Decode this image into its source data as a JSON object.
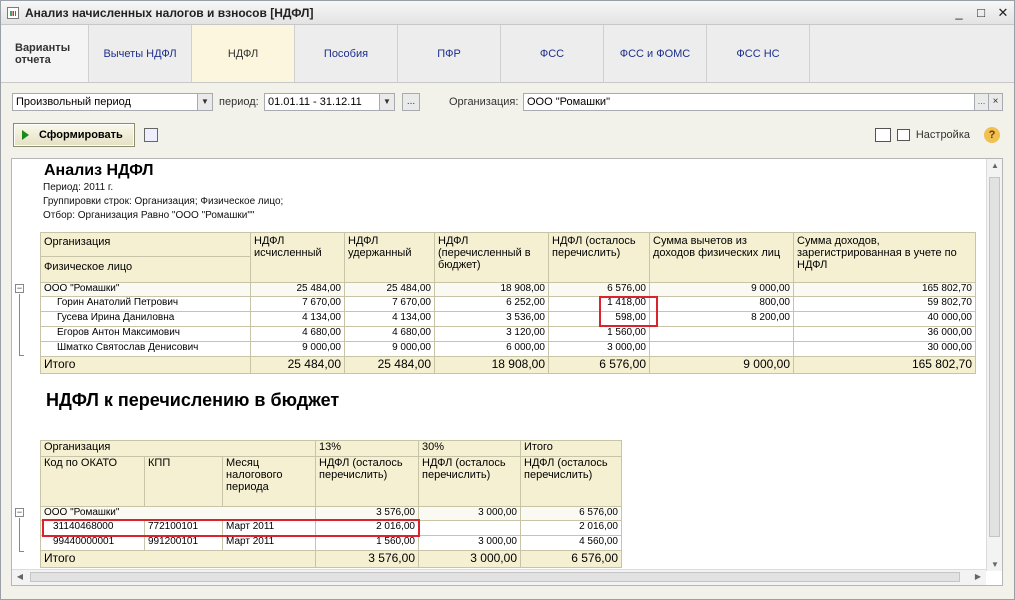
{
  "window": {
    "title": "Анализ начисленных налогов и взносов [НДФЛ]"
  },
  "tabs": [
    {
      "label": "Варианты отчета"
    },
    {
      "label": "Вычеты НДФЛ"
    },
    {
      "label": "НДФЛ"
    },
    {
      "label": "Пособия"
    },
    {
      "label": "ПФР"
    },
    {
      "label": "ФСС"
    },
    {
      "label": "ФСС и ФОМС"
    },
    {
      "label": "ФСС НС"
    }
  ],
  "params": {
    "period_type": "Произвольный период",
    "period_label": "период:",
    "period_value": "01.01.11 - 31.12.11",
    "dots": "...",
    "org_label": "Организация:",
    "org_value": "ООО \"Ромашки\"",
    "clear": "×"
  },
  "toolbar": {
    "generate_label": "Сформировать",
    "settings_label": "Настройка",
    "help": "?"
  },
  "report": {
    "title": "Анализ НДФЛ",
    "period": "Период: 2011 г.",
    "grouping": "Группировки строк: Организация; Физическое лицо;",
    "filter": "Отбор: Организация Равно \"ООО \"Ромашки\"\"",
    "t1": {
      "h_org": "Организация",
      "h_person": "Физическое лицо",
      "h_c1": "НДФЛ исчисленный",
      "h_c2": "НДФЛ удержанный",
      "h_c3": "НДФЛ (перечисленный в бюджет)",
      "h_c4": "НДФЛ (осталось перечислить)",
      "h_c5": "Сумма вычетов из доходов физических лиц",
      "h_c6": "Сумма доходов, зарегистрированная в учете по НДФЛ",
      "rows": [
        {
          "name": "ООО \"Ромашки\"",
          "c1": "25 484,00",
          "c2": "25 484,00",
          "c3": "18 908,00",
          "c4": "6 576,00",
          "c5": "9 000,00",
          "c6": "165 802,70"
        },
        {
          "name": "Горин Анатолий Петрович",
          "c1": "7 670,00",
          "c2": "7 670,00",
          "c3": "6 252,00",
          "c4": "1 418,00",
          "c5": "800,00",
          "c6": "59 802,70"
        },
        {
          "name": "Гусева Ирина Даниловна",
          "c1": "4 134,00",
          "c2": "4 134,00",
          "c3": "3 536,00",
          "c4": "598,00",
          "c5": "8 200,00",
          "c6": "40 000,00"
        },
        {
          "name": "Егоров Антон Максимович",
          "c1": "4 680,00",
          "c2": "4 680,00",
          "c3": "3 120,00",
          "c4": "1 560,00",
          "c5": "",
          "c6": "36 000,00"
        },
        {
          "name": "Шматко Святослав Денисович",
          "c1": "9 000,00",
          "c2": "9 000,00",
          "c3": "6 000,00",
          "c4": "3 000,00",
          "c5": "",
          "c6": "30 000,00"
        }
      ],
      "total": {
        "name": "Итого",
        "c1": "25 484,00",
        "c2": "25 484,00",
        "c3": "18 908,00",
        "c4": "6 576,00",
        "c5": "9 000,00",
        "c6": "165 802,70"
      }
    },
    "section2_title": "НДФЛ к перечислению в бюджет",
    "t2": {
      "h_org": "Организация",
      "h_okato": "Код по ОКАТО",
      "h_kpp": "КПП",
      "h_month": "Месяц налогового периода",
      "h_13": "13%",
      "h_30": "30%",
      "h_total": "Итого",
      "h_sub": "НДФЛ (осталось перечислить)",
      "rows": [
        {
          "okato": "ООО \"Ромашки\"",
          "kpp": "",
          "month": "",
          "p13": "3 576,00",
          "p30": "3 000,00",
          "tot": "6 576,00"
        },
        {
          "okato": "31140468000",
          "kpp": "772100101",
          "month": "Март 2011",
          "p13": "2 016,00",
          "p30": "",
          "tot": "2 016,00"
        },
        {
          "okato": "99440000001",
          "kpp": "991200101",
          "month": "Март 2011",
          "p13": "1 560,00",
          "p30": "3 000,00",
          "tot": "4 560,00"
        }
      ],
      "total": {
        "name": "Итого",
        "p13": "3 576,00",
        "p30": "3 000,00",
        "tot": "6 576,00"
      }
    }
  }
}
